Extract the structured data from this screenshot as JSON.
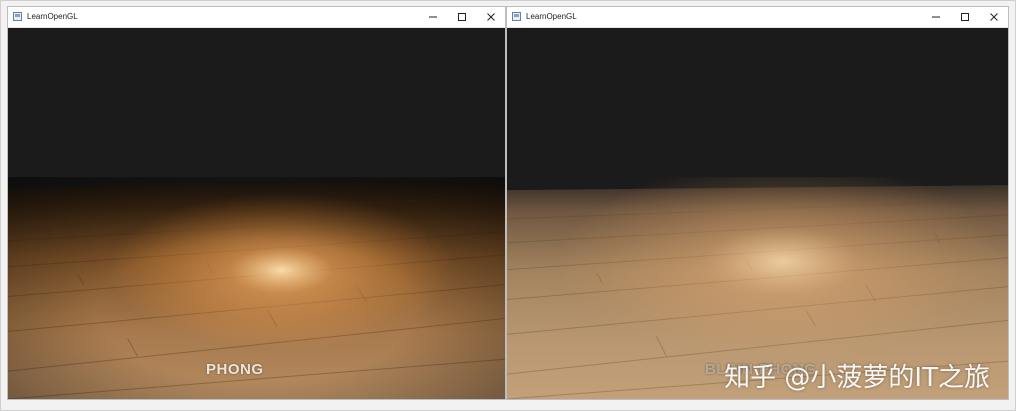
{
  "windows": [
    {
      "title": "LearnOpenGL",
      "mode_label": "PHONG",
      "controls": {
        "minimize": "minimize",
        "maximize": "maximize",
        "close": "close"
      }
    },
    {
      "title": "LearnOpenGL",
      "mode_label": "BLINN-PHONG",
      "controls": {
        "minimize": "minimize",
        "maximize": "maximize",
        "close": "close"
      }
    }
  ],
  "watermark": "知乎 @小菠萝的IT之旅",
  "colors": {
    "background_dark": "#1b1b1b",
    "wood_base": "#b88a5b",
    "wood_dark": "#4a2f17",
    "highlight": "#ffd9a0"
  },
  "icons": [
    "app-icon",
    "minimize-icon",
    "maximize-icon",
    "close-icon"
  ]
}
